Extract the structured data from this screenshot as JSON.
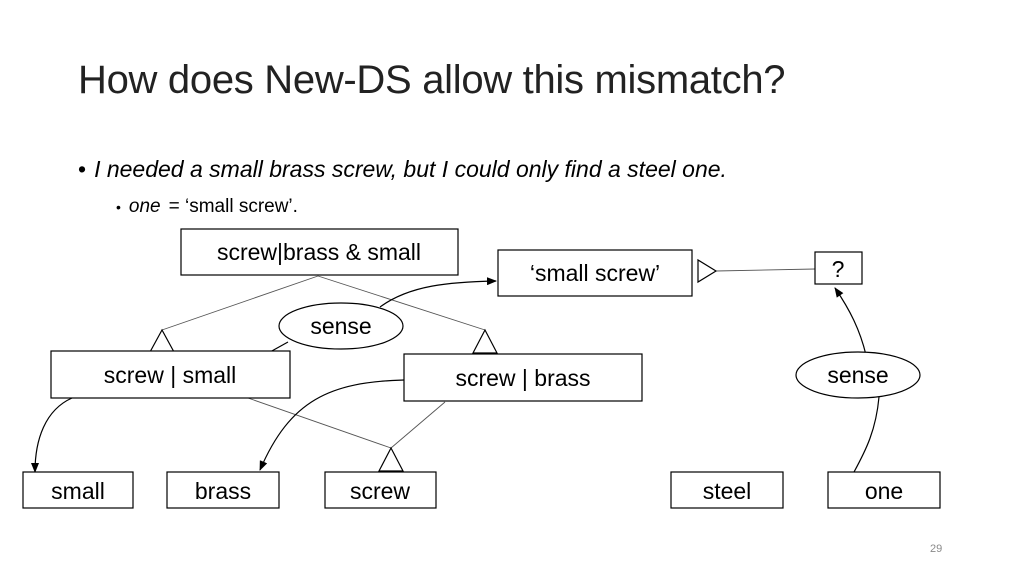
{
  "slide": {
    "title": "How does New-DS allow this mismatch?",
    "bullet_1": "I needed a small brass screw, but I could only find a steel one.",
    "bullet_2_term": "one",
    "bullet_2_rest": "= ‘small screw’.",
    "page_number": "29"
  },
  "diagram": {
    "nodes": {
      "screw_brass_small": "screw|brass & small",
      "small_screw_sense": "‘small screw’",
      "question": "?",
      "sense_left": "sense",
      "screw_small": "screw | small",
      "screw_brass": "screw | brass",
      "sense_right": "sense",
      "small": "small",
      "brass": "brass",
      "screw": "screw",
      "steel": "steel",
      "one": "one"
    }
  }
}
